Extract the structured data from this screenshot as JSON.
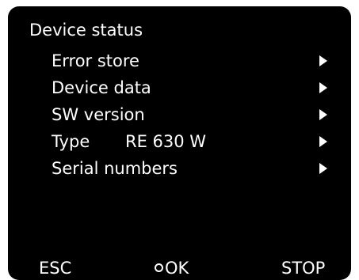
{
  "screen": {
    "title": "Device status",
    "background_color": "#000000",
    "text_color": "#ffffff"
  },
  "menu": {
    "items": [
      {
        "label": "Error store",
        "value": "",
        "icon": "triangle-right-icon"
      },
      {
        "label": "Device data",
        "value": "",
        "icon": "triangle-right-icon"
      },
      {
        "label": "SW version",
        "value": "",
        "icon": "triangle-right-icon"
      },
      {
        "label": "Type",
        "value": "RE 630 W",
        "icon": "triangle-right-icon"
      },
      {
        "label": "Serial numbers",
        "value": "",
        "icon": "triangle-right-icon"
      }
    ]
  },
  "softkeys": {
    "esc": "ESC",
    "ok": "OK",
    "ok_icon": "circle-icon",
    "stop": "STOP"
  }
}
